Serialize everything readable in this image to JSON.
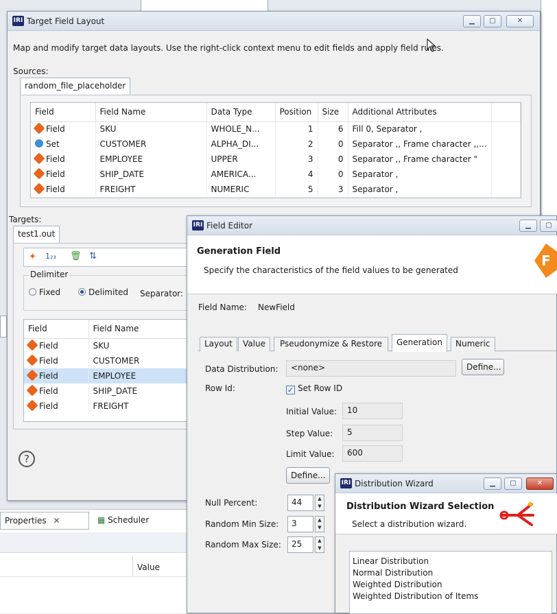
{
  "target_window": {
    "title": "Target Field Layout",
    "description": "Map and modify target data layouts. Use the right-click context menu to edit fields and apply field rules.",
    "sources_label": "Sources:",
    "source_tab": "random_file_placeholder",
    "targets_label": "Targets:",
    "target_tab": "test1.out",
    "delimiter_label": "Delimiter",
    "fixed_label": "Fixed",
    "delimited_label": "Delimited",
    "separator_label": "Separator:",
    "sources_table": {
      "headers": [
        "Field",
        "Field Name",
        "Data Type",
        "Position",
        "Size",
        "Additional Attributes"
      ],
      "rows": [
        {
          "kind": "Field",
          "name": "SKU",
          "type": "WHOLE_N...",
          "position": "1",
          "size": "6",
          "attrs": "Fill 0, Separator ,"
        },
        {
          "kind": "Set",
          "name": "CUSTOMER",
          "type": "ALPHA_DI...",
          "position": "2",
          "size": "0",
          "attrs": "Separator ,, Frame character ,,..."
        },
        {
          "kind": "Field",
          "name": "EMPLOYEE",
          "type": "UPPER",
          "position": "3",
          "size": "0",
          "attrs": "Separator ,, Frame character \""
        },
        {
          "kind": "Field",
          "name": "SHIP_DATE",
          "type": "AMERICA...",
          "position": "4",
          "size": "0",
          "attrs": "Separator ,"
        },
        {
          "kind": "Field",
          "name": "FREIGHT",
          "type": "NUMERIC",
          "position": "5",
          "size": "3",
          "attrs": "Separator ,"
        }
      ]
    },
    "targets_table": {
      "headers": [
        "Field",
        "Field Name"
      ],
      "rows": [
        {
          "kind": "Field",
          "name": "SKU"
        },
        {
          "kind": "Field",
          "name": "CUSTOMER"
        },
        {
          "kind": "Field",
          "name": "EMPLOYEE"
        },
        {
          "kind": "Field",
          "name": "SHIP_DATE"
        },
        {
          "kind": "Field",
          "name": "FREIGHT"
        }
      ]
    },
    "help_glyph": "?"
  },
  "background": {
    "properties_tab": "Properties",
    "scheduler_tab": "Scheduler",
    "value_header": "Value"
  },
  "field_editor": {
    "title": "Field Editor",
    "heading": "Generation Field",
    "subheading": "Specify the characteristics of the field values to be generated",
    "field_name_label": "Field Name:",
    "field_name_value": "NewField",
    "tabs": [
      "Layout",
      "Value",
      "Pseudonymize & Restore",
      "Generation",
      "Numeric"
    ],
    "data_distribution_label": "Data Distribution:",
    "data_distribution_value": "<none>",
    "define_label": "Define...",
    "row_id_label": "Row Id:",
    "set_row_id_label": "Set Row ID",
    "initial_value_label": "Initial Value:",
    "initial_value": "10",
    "step_value_label": "Step Value:",
    "step_value": "5",
    "limit_value_label": "Limit Value:",
    "limit_value": "600",
    "define2_label": "Define...",
    "null_percent_label": "Null Percent:",
    "null_percent": "44",
    "random_min_label": "Random Min Size:",
    "random_min": "3",
    "random_max_label": "Random Max Size:",
    "random_max": "25"
  },
  "dist_wizard": {
    "title": "Distribution Wizard",
    "heading": "Distribution Wizard Selection",
    "subheading": "Select a distribution wizard.",
    "items": [
      "Linear Distribution",
      "Normal Distribution",
      "Weighted Distribution",
      "Weighted Distribution of Items"
    ]
  },
  "colors": {
    "titlebar": "#d6dfea",
    "field_icon": "#e8641c",
    "set_icon": "#3f8fd6",
    "selection": "#cde2f7",
    "logo_red": "#e0201e",
    "logo_orange": "#f28a1e"
  }
}
